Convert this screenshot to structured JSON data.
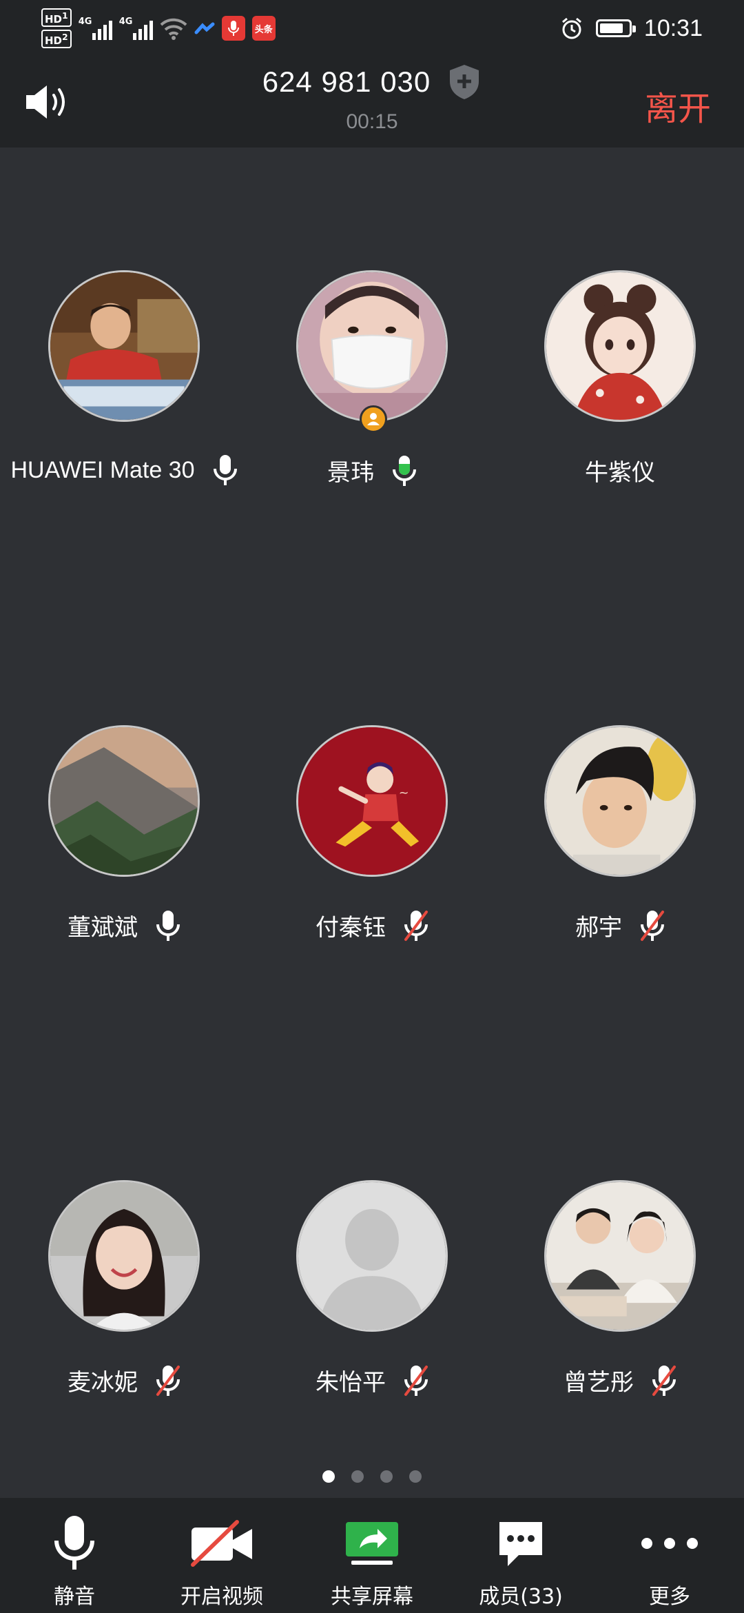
{
  "status_bar": {
    "sim1": "HD",
    "sim1_num": "1",
    "sim2": "HD",
    "sim2_num": "2",
    "network1": "4G",
    "network2": "4G",
    "app_badge": "头条",
    "time": "10:31",
    "battery_level": 0.82
  },
  "header": {
    "meeting_id": "624 981 030",
    "timer": "00:15",
    "leave_label": "离开"
  },
  "participants": [
    {
      "name": "HUAWEI Mate 30",
      "mic": "on",
      "avatar": "boy-computer-photo"
    },
    {
      "name": "景玮",
      "mic": "speaking",
      "avatar": "baby-mask-photo",
      "host": true
    },
    {
      "name": "牛紫仪",
      "mic": "none",
      "avatar": "anime-girl-illustration"
    },
    {
      "name": "董斌斌",
      "mic": "on",
      "avatar": "mountain-photo"
    },
    {
      "name": "付秦钰",
      "mic": "muted",
      "avatar": "red-cartoon-illustration"
    },
    {
      "name": "郝宇",
      "mic": "muted",
      "avatar": "young-man-photo"
    },
    {
      "name": "麦冰妮",
      "mic": "muted",
      "avatar": "smiling-woman-photo"
    },
    {
      "name": "朱怡平",
      "mic": "muted",
      "avatar": "default-avatar"
    },
    {
      "name": "曾艺彤",
      "mic": "muted",
      "avatar": "couple-photo"
    }
  ],
  "pagination": {
    "pages": 4,
    "current": 1
  },
  "toolbar": {
    "mute_label": "静音",
    "video_label": "开启视频",
    "share_label": "共享屏幕",
    "members_label": "成员(33)",
    "more_label": "更多"
  },
  "colors": {
    "background": "#2e3034",
    "bar": "#222426",
    "leave": "#f4554a",
    "speaking": "#33c24d",
    "muted": "#e64a3f",
    "host_badge": "#f0a01e",
    "share_icon": "#2fb24b"
  }
}
